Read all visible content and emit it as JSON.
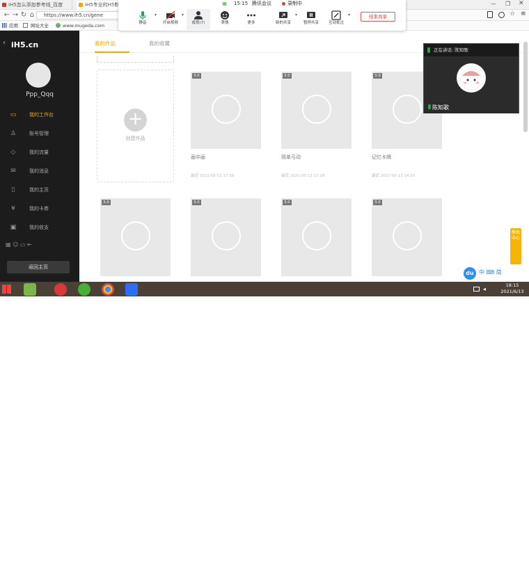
{
  "browser": {
    "tabs": [
      {
        "label": "iH5怎么添加参考线_百度"
      },
      {
        "label": "iH5专业的H5制作"
      }
    ],
    "nav": {
      "back": "←",
      "forward": "→",
      "reload": "↻",
      "home": "⌂"
    },
    "url": "https://www.ih5.cn/gene",
    "bookmarks": [
      "应用",
      "网址大全",
      "www.mugeda.com"
    ]
  },
  "meeting": {
    "time": "15:15",
    "title": "腾讯会议",
    "recording": "录制中",
    "tools": [
      {
        "label": "静音",
        "icon": "mic-icon"
      },
      {
        "label": "开启视频",
        "icon": "camera-off-icon"
      },
      {
        "label": "成员(7)",
        "icon": "members-icon"
      },
      {
        "label": "表情",
        "icon": "emoji-icon"
      },
      {
        "label": "更多",
        "icon": "more-icon"
      },
      {
        "label": "新的共享",
        "icon": "share-icon"
      },
      {
        "label": "暂停共享",
        "icon": "pause-icon"
      },
      {
        "label": "互动批注",
        "icon": "annotate-icon"
      }
    ],
    "end_share": "结束共享",
    "speaker": {
      "label": "正在讲话: 陈知歌",
      "name": "陈知歌"
    }
  },
  "sidebar": {
    "logo": "iH5.cn",
    "username": "Ppp_Qqq",
    "items": [
      {
        "label": "我的工作台",
        "icon": "monitor-icon",
        "active": true
      },
      {
        "label": "账号管理",
        "icon": "user-icon",
        "active": false
      },
      {
        "label": "我的流量",
        "icon": "traffic-icon",
        "active": false
      },
      {
        "label": "我的消息",
        "icon": "mail-icon",
        "active": false
      },
      {
        "label": "我的主页",
        "icon": "page-icon",
        "active": false
      },
      {
        "label": "我的卡券",
        "icon": "coupon-icon",
        "active": false
      },
      {
        "label": "我的收支",
        "icon": "wallet-icon",
        "active": false
      }
    ],
    "home_button": "返回主页"
  },
  "main": {
    "tabs": [
      "我的作品",
      "我的收藏"
    ],
    "new_label": "创建作品",
    "cards": [
      {
        "badge": "3.0",
        "title": "画中画",
        "sub": "",
        "date": "最近 2021-05-13 17:38"
      },
      {
        "badge": "3.0",
        "title": "简单弓动",
        "sub": "",
        "date": "最近 2021-05-13 17:19"
      },
      {
        "badge": "3.0",
        "title": "记忆卡牌",
        "sub": "",
        "date": "最近 2021-05-13 14:50"
      },
      {
        "badge": "3.0",
        "title": "",
        "sub": "",
        "date": ""
      },
      {
        "badge": "3.0",
        "title": "",
        "sub": "",
        "date": ""
      },
      {
        "badge": "3.0",
        "title": "",
        "sub": "",
        "date": ""
      },
      {
        "badge": "3.0",
        "title": "",
        "sub": "",
        "date": ""
      }
    ]
  },
  "help": "帮助中心",
  "taskbar": {
    "ime": "中 ·, 简",
    "time": "18:15",
    "date": "2021/6/13",
    "imebar": "中 ⌨ 简"
  }
}
